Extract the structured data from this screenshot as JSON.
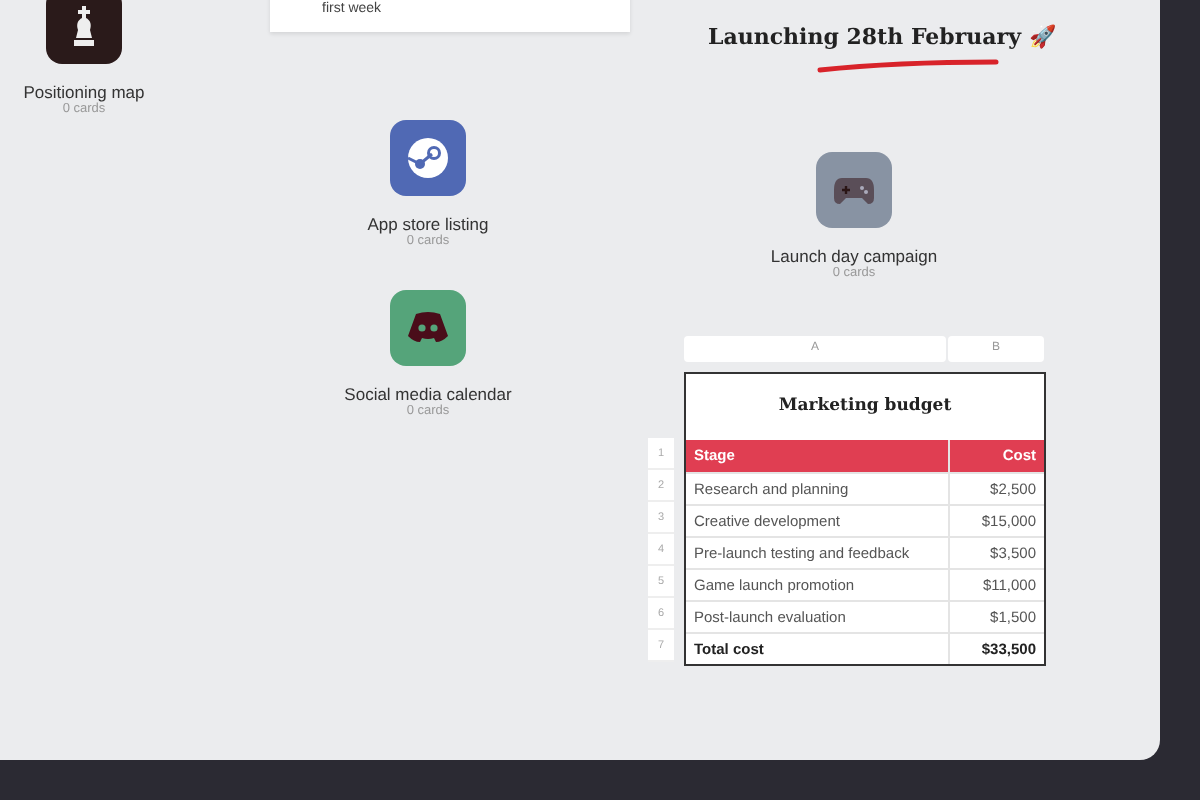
{
  "note": {
    "text": "first week"
  },
  "heading": {
    "text": "Launching 28th February",
    "emoji": "🚀"
  },
  "boards": [
    {
      "name": "Positioning map",
      "count": "0 cards",
      "kind": "chess",
      "color": "#2a1a1a"
    },
    {
      "name": "App store listing",
      "count": "0 cards",
      "kind": "steam",
      "color": "#5069b4"
    },
    {
      "name": "Social media calendar",
      "count": "0 cards",
      "kind": "discord",
      "color": "#55a47a"
    },
    {
      "name": "Launch day campaign",
      "count": "0 cards",
      "kind": "gamepad",
      "color": "#8893a3"
    }
  ],
  "sheet": {
    "columns": [
      "A",
      "B"
    ],
    "title": "Marketing budget",
    "rows": [
      {
        "number": "1",
        "kind": "header",
        "cells": [
          "Stage",
          "Cost"
        ]
      },
      {
        "number": "2",
        "kind": "data",
        "cells": [
          "Research and planning",
          "$2,500"
        ]
      },
      {
        "number": "3",
        "kind": "data",
        "cells": [
          "Creative development",
          "$15,000"
        ]
      },
      {
        "number": "4",
        "kind": "data",
        "cells": [
          "Pre-launch testing and feedback",
          "$3,500"
        ]
      },
      {
        "number": "5",
        "kind": "data",
        "cells": [
          "Game launch promotion",
          "$11,000"
        ]
      },
      {
        "number": "6",
        "kind": "data",
        "cells": [
          "Post-launch evaluation",
          "$1,500"
        ]
      },
      {
        "number": "7",
        "kind": "total",
        "cells": [
          "Total cost",
          "$33,500"
        ]
      }
    ]
  }
}
